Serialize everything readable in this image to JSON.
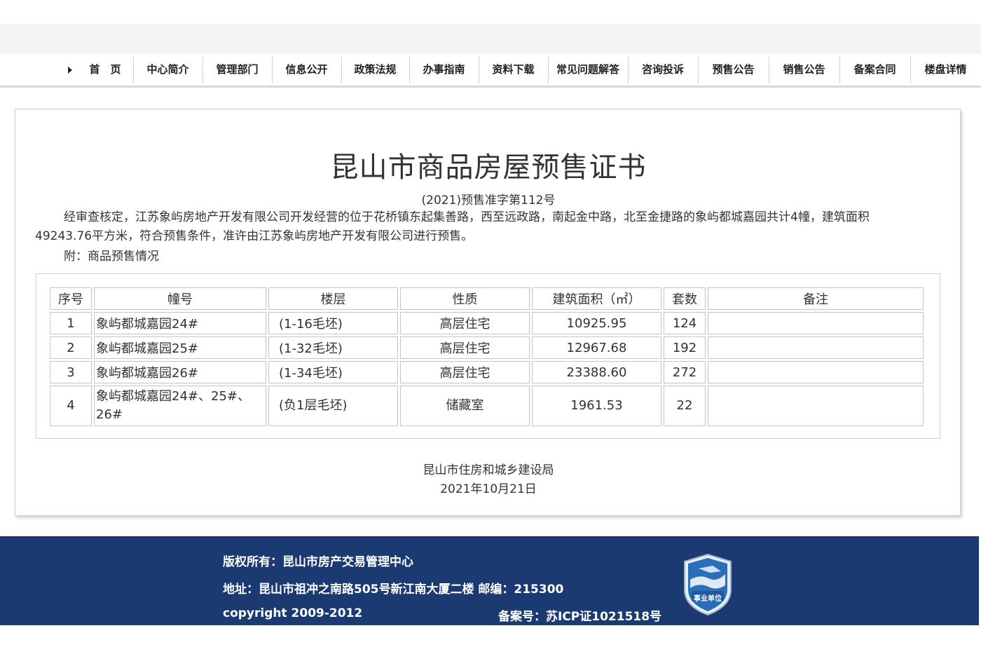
{
  "nav": {
    "items": [
      "首　页",
      "中心简介",
      "管理部门",
      "信息公开",
      "政策法规",
      "办事指南",
      "资料下载",
      "常见问题解答",
      "咨询投诉",
      "预售公告",
      "销售公告",
      "备案合同",
      "楼盘详情"
    ]
  },
  "certificate": {
    "title": "昆山市商品房屋预售证书",
    "number": "(2021)预售准字第112号",
    "body": "经审查核定，江苏象屿房地产开发有限公司开发经营的位于花桥镇东起集善路，西至远政路，南起金中路，北至金捷路的象屿都城嘉园共计4幢，建筑面积49243.76平方米，符合预售条件，准许由江苏象屿房地产开发有限公司进行预售。",
    "attachment": "附：商品预售情况",
    "table": {
      "headers": [
        "序号",
        "幢号",
        "楼层",
        "性质",
        "建筑面积（㎡）",
        "套数",
        "备注"
      ],
      "rows": [
        [
          "1",
          "象屿都城嘉园24#",
          "(1-16毛坯)",
          "高层住宅",
          "10925.95",
          "124",
          ""
        ],
        [
          "2",
          "象屿都城嘉园25#",
          "(1-32毛坯)",
          "高层住宅",
          "12967.68",
          "192",
          ""
        ],
        [
          "3",
          "象屿都城嘉园26#",
          "(1-34毛坯)",
          "高层住宅",
          "23388.60",
          "272",
          ""
        ],
        [
          "4",
          "象屿都城嘉园24#、25#、26#",
          "(负1层毛坯)",
          "储藏室",
          "1961.53",
          "22",
          ""
        ]
      ]
    },
    "issuer": "昆山市住房和城乡建设局",
    "date": "2021年10月21日"
  },
  "footer": {
    "copyright_owner": "版权所有：昆山市房产交易管理中心",
    "address": "地址：昆山市祖冲之南路505号新江南大厦二楼 邮编：215300",
    "copyright_years": "copyright 2009-2012",
    "icp": "备案号：苏ICP证1021518号",
    "badge_text": "事业单位"
  },
  "colors": {
    "footer_bg": "#1b3a72",
    "badge_blue": "#2a6fb8"
  }
}
